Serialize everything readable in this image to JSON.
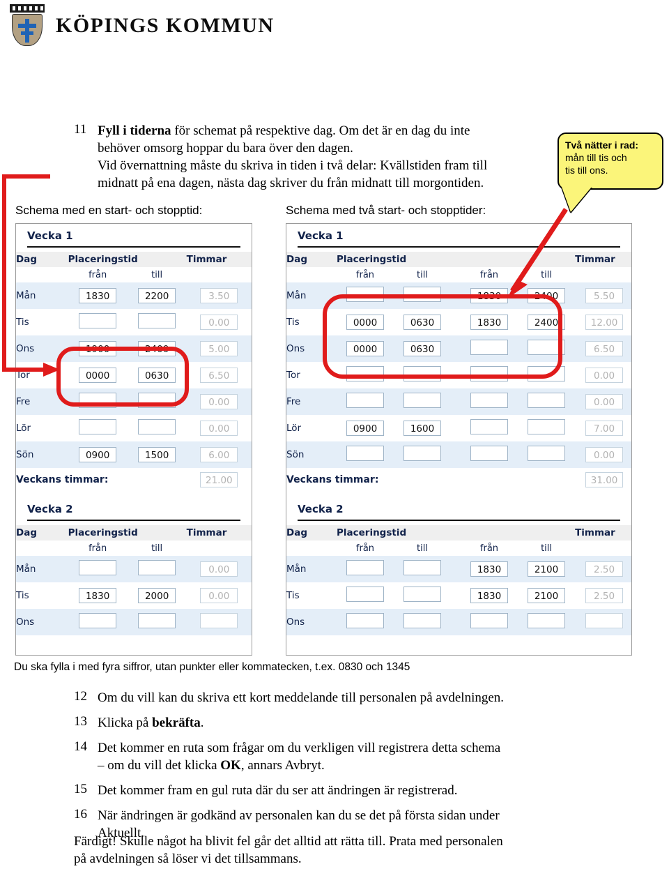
{
  "header": {
    "organization": "KÖPINGS KOMMUN",
    "crest_icon": "coat-of-arms-shield-icon"
  },
  "step11": {
    "number": "11",
    "lead_bold": "Fyll i tiderna",
    "line1_rest": " för schemat på respektive dag. Om det är en dag du inte",
    "line2": "behöver omsorg hoppar du bara över den dagen.",
    "line3": "Vid övernattning måste du skriva in tiden i två delar: Kvällstiden fram till",
    "line4": "midnatt på ena dagen, nästa dag skriver du från midnatt till morgontiden."
  },
  "callout": {
    "title": "Två nätter i rad:",
    "line2": "mån till tis och",
    "line3": "tis till ons."
  },
  "captions": {
    "left": "Schema med en start- och stopptid:",
    "right": "Schema med två start- och stopptider:"
  },
  "columns": {
    "day": "Dag",
    "placeringstid": "Placeringstid",
    "timmar": "Timmar",
    "fran": "från",
    "till": "till",
    "weektotal": "Veckans timmar:"
  },
  "left_panel": {
    "week1": {
      "title": "Vecka 1",
      "rows": [
        {
          "day": "Mån",
          "from": "1830",
          "to": "2200",
          "hours": "3.50"
        },
        {
          "day": "Tis",
          "from": "",
          "to": "",
          "hours": "0.00"
        },
        {
          "day": "Ons",
          "from": "1900",
          "to": "2400",
          "hours": "5.00"
        },
        {
          "day": "Tor",
          "from": "0000",
          "to": "0630",
          "hours": "6.50"
        },
        {
          "day": "Fre",
          "from": "",
          "to": "",
          "hours": "0.00"
        },
        {
          "day": "Lör",
          "from": "",
          "to": "",
          "hours": "0.00"
        },
        {
          "day": "Sön",
          "from": "0900",
          "to": "1500",
          "hours": "6.00"
        }
      ],
      "total": "21.00"
    },
    "week2": {
      "title": "Vecka 2",
      "rows": [
        {
          "day": "Mån",
          "from": "",
          "to": "",
          "hours": "0.00"
        },
        {
          "day": "Tis",
          "from": "1830",
          "to": "2000",
          "hours": "0.00"
        },
        {
          "day": "Ons",
          "from": "",
          "to": "",
          "hours": ""
        }
      ]
    }
  },
  "right_panel": {
    "week1": {
      "title": "Vecka 1",
      "rows": [
        {
          "day": "Mån",
          "from1": "",
          "to1": "",
          "from2": "1830",
          "to2": "2400",
          "hours": "5.50"
        },
        {
          "day": "Tis",
          "from1": "0000",
          "to1": "0630",
          "from2": "1830",
          "to2": "2400",
          "hours": "12.00"
        },
        {
          "day": "Ons",
          "from1": "0000",
          "to1": "0630",
          "from2": "",
          "to2": "",
          "hours": "6.50"
        },
        {
          "day": "Tor",
          "from1": "",
          "to1": "",
          "from2": "",
          "to2": "",
          "hours": "0.00"
        },
        {
          "day": "Fre",
          "from1": "",
          "to1": "",
          "from2": "",
          "to2": "",
          "hours": "0.00"
        },
        {
          "day": "Lör",
          "from1": "0900",
          "to1": "1600",
          "from2": "",
          "to2": "",
          "hours": "7.00"
        },
        {
          "day": "Sön",
          "from1": "",
          "to1": "",
          "from2": "",
          "to2": "",
          "hours": "0.00"
        }
      ],
      "total": "31.00"
    },
    "week2": {
      "title": "Vecka 2",
      "rows": [
        {
          "day": "Mån",
          "from1": "",
          "to1": "",
          "from2": "1830",
          "to2": "2100",
          "hours": "2.50"
        },
        {
          "day": "Tis",
          "from1": "",
          "to1": "",
          "from2": "1830",
          "to2": "2100",
          "hours": "2.50"
        },
        {
          "day": "Ons",
          "from1": "",
          "to1": "",
          "from2": "",
          "to2": "",
          "hours": ""
        }
      ]
    }
  },
  "note": "Du ska fylla i med fyra siffror, utan punkter eller kommatecken, t.ex. 0830 och 1345",
  "steps": [
    {
      "n": "12",
      "text": "Om du vill kan du skriva ett kort meddelande till personalen på avdelningen."
    },
    {
      "n": "13",
      "text_pre": "Klicka på ",
      "bold": "bekräfta",
      "text_post": "."
    },
    {
      "n": "14",
      "line1": "Det kommer en ruta som frågar om du verkligen vill registrera detta schema",
      "line2_pre": "– om du vill det klicka ",
      "bold": "OK",
      "line2_post": ", annars Avbryt."
    },
    {
      "n": "15",
      "text": "Det kommer fram en gul ruta där du ser att ändringen är registrerad."
    },
    {
      "n": "16",
      "line1": "När ändringen är godkänd av personalen kan du se det på första sidan under",
      "line2": "Aktuellt."
    }
  ],
  "closing": {
    "line1": "Färdigt! Skulle något ha blivit fel går det alltid att rätta till. Prata med personalen",
    "line2": "på avdelningen så löser vi det tillsammans."
  },
  "colors": {
    "accent_red": "#e01b1b",
    "callout_yellow": "#fbf57a",
    "row_alt": "#e4eef8",
    "header_grey": "#efefef",
    "navy_text": "#11224a"
  }
}
